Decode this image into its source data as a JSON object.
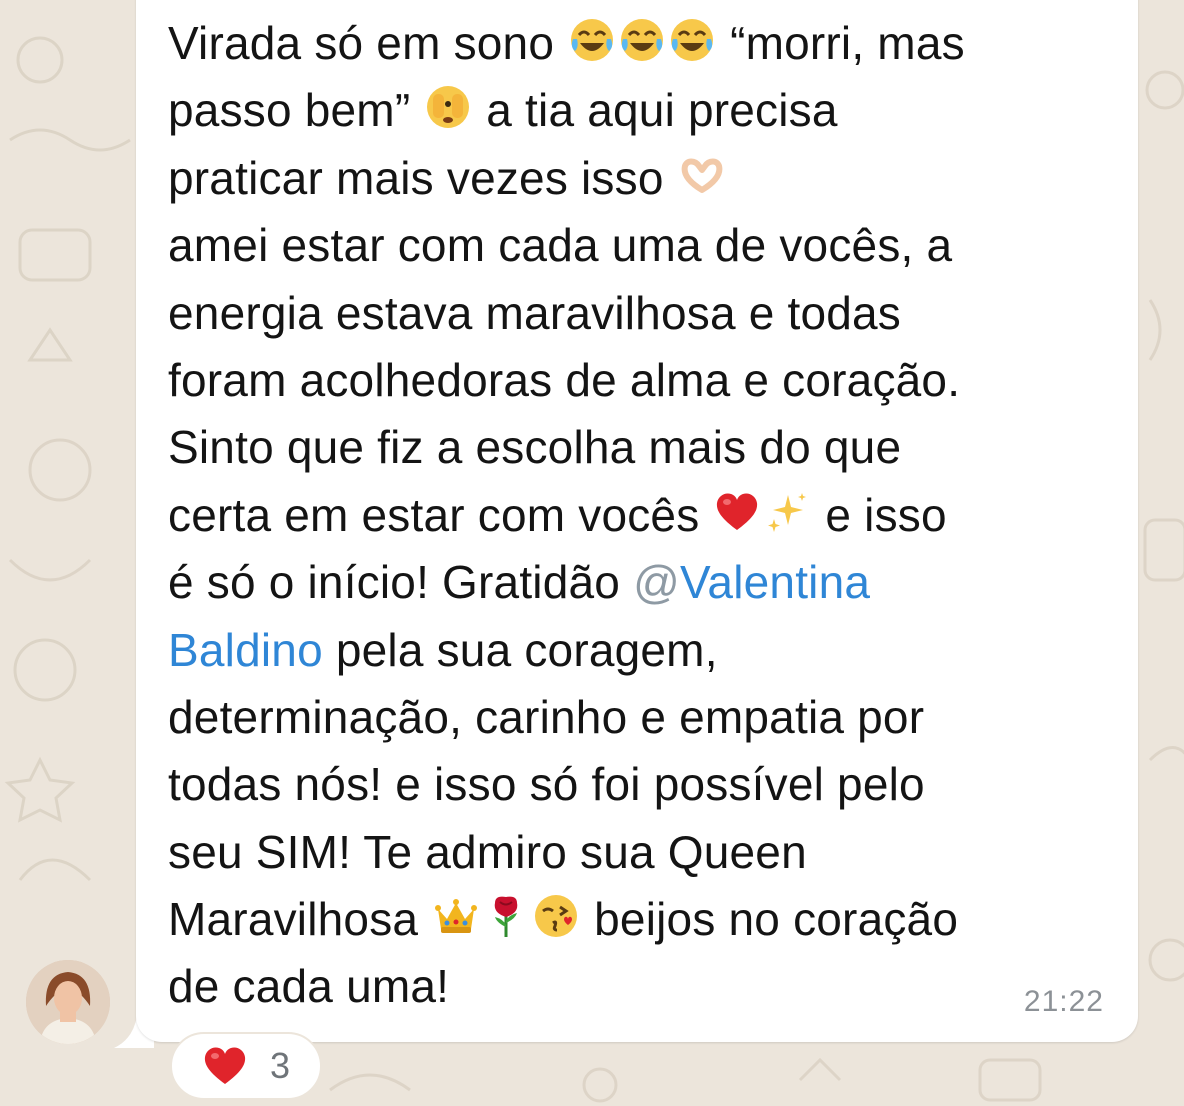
{
  "message": {
    "lines": [
      [
        "Virada só em sono ",
        " “morri, mas"
      ],
      [
        "passo bem” ",
        " a tia aqui precisa"
      ],
      [
        "praticar mais vezes isso "
      ],
      [
        "amei estar com cada uma de vocês, a"
      ],
      [
        "energia estava maravilhosa e todas"
      ],
      [
        "foram acolhedoras de alma e coração."
      ],
      [
        "Sinto que fiz a escolha mais do que"
      ],
      [
        "certa em estar com vocês ",
        " e isso"
      ],
      [
        "é só o início! Gratidão "
      ],
      [
        " pela sua coragem,"
      ],
      [
        "determinação, carinho e empatia por"
      ],
      [
        "todas nós! e isso só foi possível pelo"
      ],
      [
        "seu SIM! Te admiro sua Queen"
      ],
      [
        "Maravilhosa ",
        " beijos no coração"
      ],
      [
        "de cada uma!"
      ]
    ],
    "mention_at": "@",
    "mention_first": "Valentina",
    "mention_last": "Baldino",
    "timestamp": "21:22"
  },
  "icons": {
    "laughing": "face-with-tears-of-joy-icon",
    "peeking": "face-with-peeking-eye-icon",
    "heart_hands": "heart-hands-icon",
    "red_heart": "red-heart-icon",
    "sparkles": "sparkles-icon",
    "crown": "crown-icon",
    "rose": "rose-icon",
    "kiss": "face-blowing-kiss-icon"
  },
  "reaction": {
    "emoji": "red-heart-icon",
    "count": "3"
  },
  "colors": {
    "background": "#ECE5DB",
    "bubble": "#FFFFFF",
    "text": "#141414",
    "mention": "#2F86D6",
    "timestamp": "#8C9196"
  }
}
